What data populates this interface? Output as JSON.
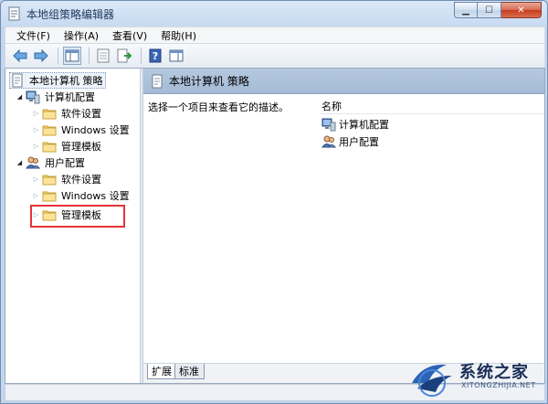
{
  "window": {
    "title": "本地组策略编辑器"
  },
  "menu": [
    {
      "label": "文件(F)"
    },
    {
      "label": "操作(A)"
    },
    {
      "label": "查看(V)"
    },
    {
      "label": "帮助(H)"
    }
  ],
  "toolbar": {
    "buttons": [
      "back-arrow",
      "forward-arrow",
      "show-hide-tree",
      "properties",
      "export-list",
      "help",
      "show-hide-action-pane"
    ]
  },
  "tree": {
    "root": "本地计算机 策略",
    "computer_config": "计算机配置",
    "computer_children": [
      "软件设置",
      "Windows 设置",
      "管理模板"
    ],
    "user_config": "用户配置",
    "user_children": [
      "软件设置",
      "Windows 设置",
      "管理模板"
    ]
  },
  "right_pane": {
    "header": "本地计算机 策略",
    "description": "选择一个项目来查看它的描述。",
    "column_name": "名称",
    "items": [
      "计算机配置",
      "用户配置"
    ]
  },
  "tabs": [
    "扩展",
    "标准"
  ],
  "watermark": {
    "text": "系统之家",
    "sub": "XITONGZHIJIA.NET"
  },
  "colors": {
    "highlight_box": "#e53338",
    "header_bar": "#a4bbd6"
  }
}
